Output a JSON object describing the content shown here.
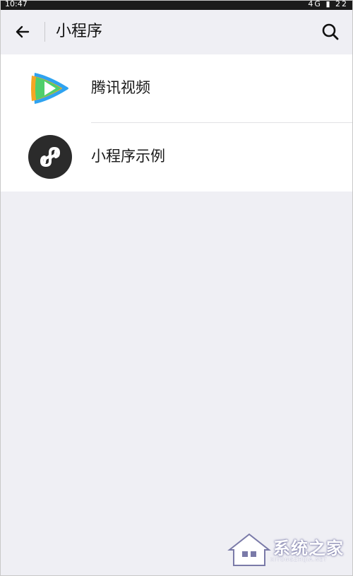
{
  "status_bar": {
    "time": "10:47",
    "right_indicators": "4G ▮ 22"
  },
  "header": {
    "title": "小程序"
  },
  "list": {
    "items": [
      {
        "label": "腾讯视频",
        "icon": "tencent-video-logo-icon"
      },
      {
        "label": "小程序示例",
        "icon": "mini-program-logo-icon"
      }
    ]
  },
  "watermark": {
    "text": "系统之家",
    "subtext": "XITONGZHIJIA.NET"
  },
  "colors": {
    "background": "#efeff4",
    "list_background": "#ffffff",
    "status_bar": "#1b1b1b",
    "mini_program_icon_bg": "#2b2b2b"
  }
}
